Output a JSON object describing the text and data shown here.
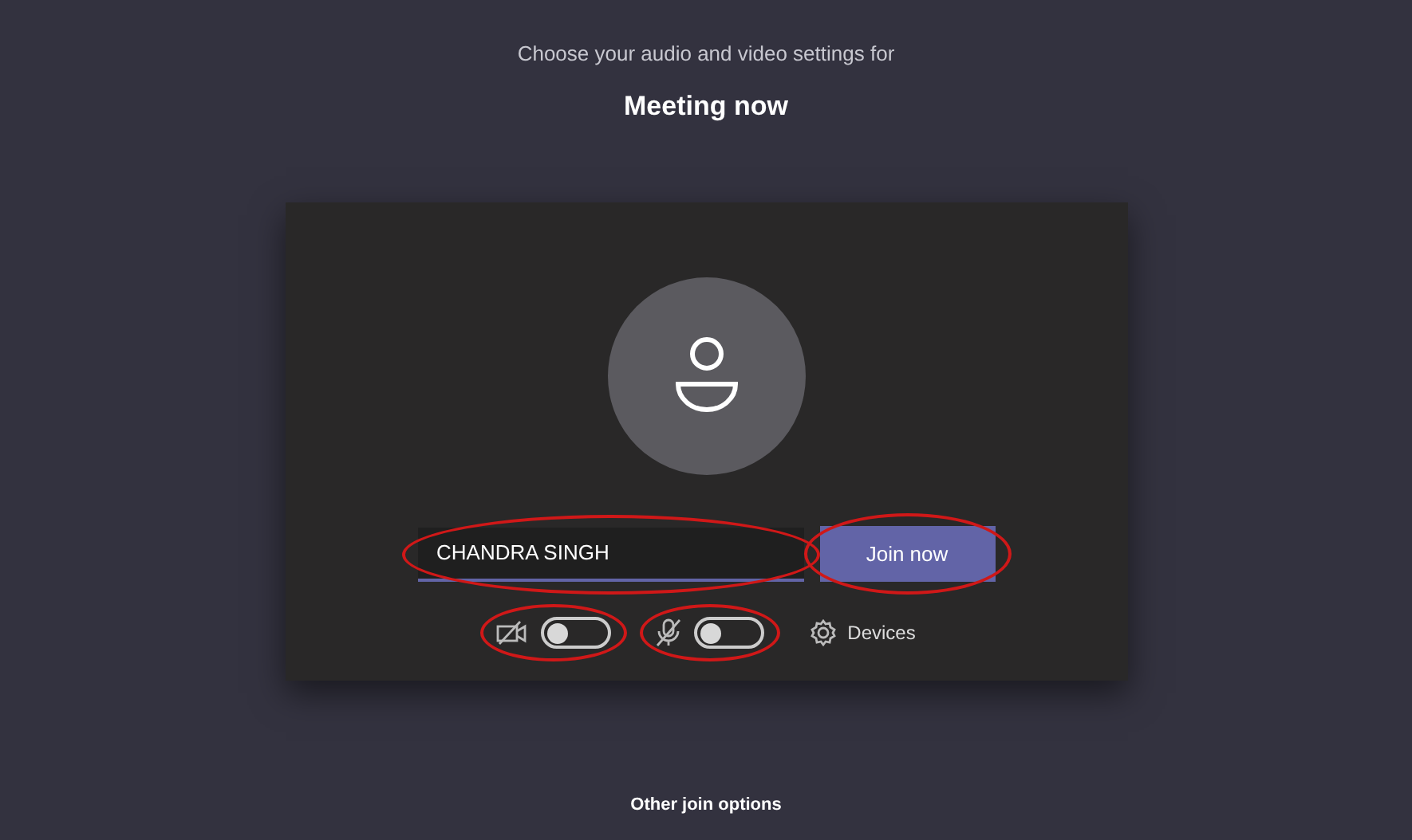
{
  "header": {
    "subtitle": "Choose your audio and video settings for",
    "title": "Meeting now"
  },
  "name_field": {
    "value": "CHANDRA SINGH",
    "highlighted": true
  },
  "join_button": {
    "label": "Join now",
    "highlighted": true
  },
  "toggles": [
    {
      "kind": "camera",
      "on": false,
      "highlighted": true
    },
    {
      "kind": "microphone",
      "on": false,
      "highlighted": true
    }
  ],
  "devices_button": {
    "label": "Devices"
  },
  "footer_link": "Other join options"
}
